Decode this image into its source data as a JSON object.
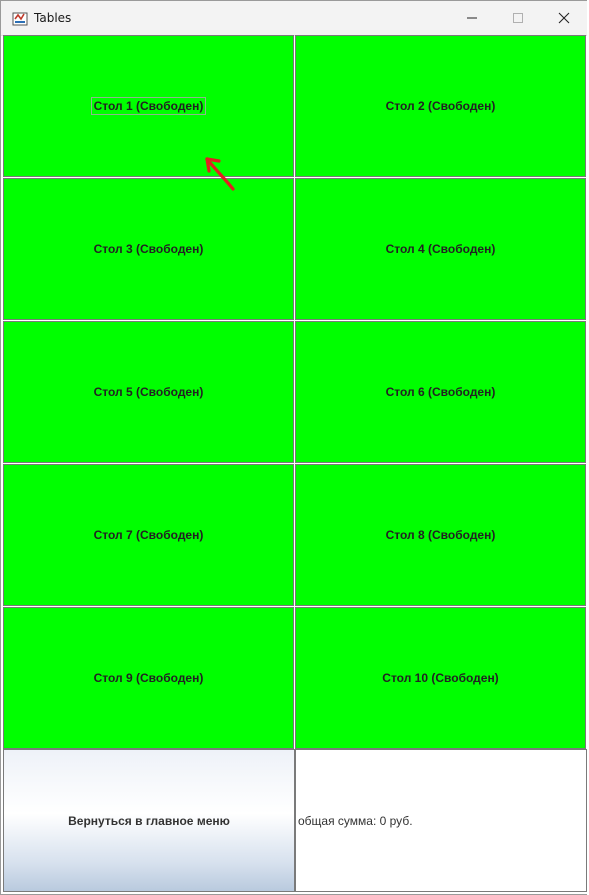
{
  "window": {
    "title": "Tables"
  },
  "tables": [
    {
      "label": "Стол 1 (Свободен)",
      "focused": true
    },
    {
      "label": "Стол 2 (Свободен)",
      "focused": false
    },
    {
      "label": "Стол 3 (Свободен)",
      "focused": false
    },
    {
      "label": "Стол 4 (Свободен)",
      "focused": false
    },
    {
      "label": "Стол 5 (Свободен)",
      "focused": false
    },
    {
      "label": "Стол 6 (Свободен)",
      "focused": false
    },
    {
      "label": "Стол 7 (Свободен)",
      "focused": false
    },
    {
      "label": "Стол 8 (Свободен)",
      "focused": false
    },
    {
      "label": "Стол 9 (Свободен)",
      "focused": false
    },
    {
      "label": "Стол 10 (Свободен)",
      "focused": false
    }
  ],
  "footer": {
    "back_label": "Вернуться в главное меню",
    "total_label": "общая сумма: 0 руб."
  },
  "colors": {
    "table_free": "#00ff00",
    "annotation_arrow": "#e02020"
  }
}
